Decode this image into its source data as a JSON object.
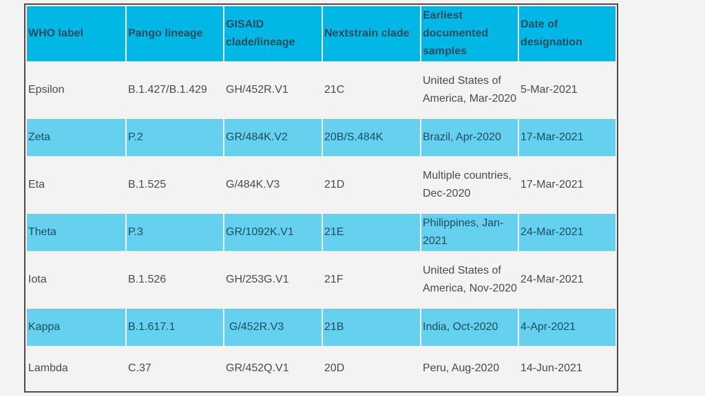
{
  "table": {
    "headers": [
      "WHO label",
      "Pango lineage",
      "GISAID clade/lineage",
      "Nextstrain clade",
      "Earliest documented samples",
      "Date of designation"
    ],
    "rows": [
      {
        "who": "Epsilon",
        "pango": "B.1.427/B.1.429",
        "gisaid": "GH/452R.V1",
        "nextstrain": "21C",
        "earliest": "United States of America, Mar-2020",
        "date": "5-Mar-2021"
      },
      {
        "who": "Zeta",
        "pango": "P.2",
        "gisaid": "GR/484K.V2",
        "nextstrain": "20B/S.484K",
        "earliest": "Brazil, Apr-2020",
        "date": "17-Mar-2021"
      },
      {
        "who": "Eta",
        "pango": "B.1.525",
        "gisaid": "G/484K.V3",
        "nextstrain": "21D",
        "earliest": "Multiple countries, Dec-2020",
        "date": "17-Mar-2021"
      },
      {
        "who": "Theta",
        "pango": "P.3",
        "gisaid": "GR/1092K.V1",
        "nextstrain": "21E",
        "earliest": "Philippines, Jan-2021",
        "date": "24-Mar-2021"
      },
      {
        "who": "Iota",
        "pango": "B.1.526",
        "gisaid": "GH/253G.V1",
        "nextstrain": "21F",
        "earliest": "United States of America, Nov-2020",
        "date": "24-Mar-2021"
      },
      {
        "who": "Kappa",
        "pango": "B.1.617.1",
        "gisaid": "G/452R.V3",
        "nextstrain": "21B",
        "earliest": "India, Oct-2020",
        "date": "4-Apr-2021"
      },
      {
        "who": "Lambda",
        "pango": "C.37",
        "gisaid": "GR/452Q.V1",
        "nextstrain": "20D",
        "earliest": "Peru, Aug-2020",
        "date": "14-Jun-2021"
      }
    ]
  },
  "colors": {
    "header_bg": "#00b7e6",
    "highlight_row_bg": "#66d1ee",
    "plain_row_bg": "#f3f3f3",
    "header_text": "#1b4d5e",
    "body_text": "#4a4a4a"
  }
}
